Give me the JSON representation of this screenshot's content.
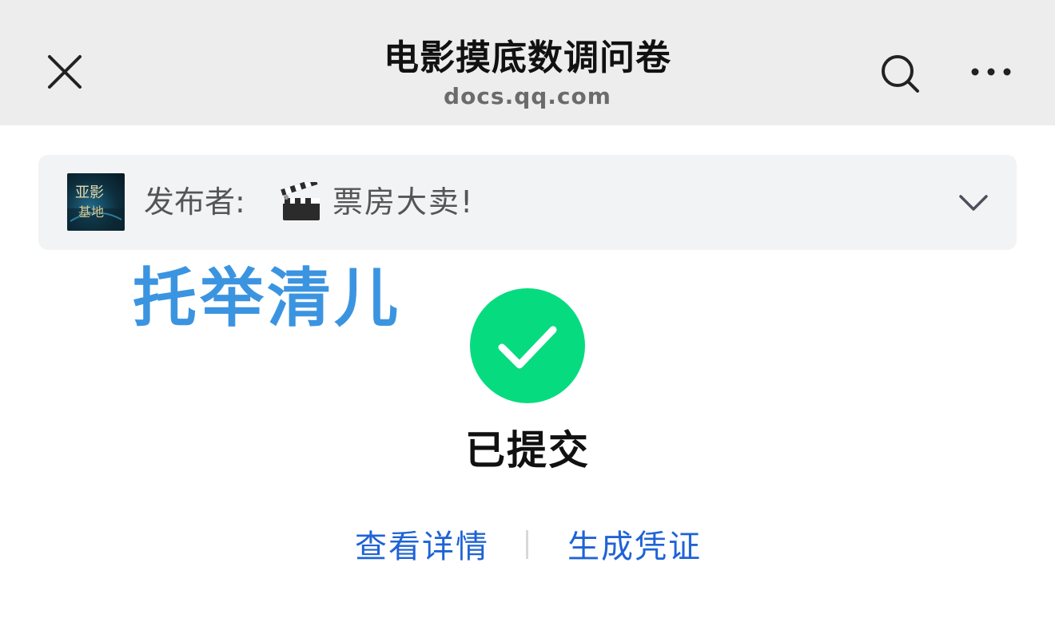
{
  "header": {
    "title": "电影摸底数调问卷",
    "subtitle": "docs.qq.com",
    "close_icon": "close-icon",
    "search_icon": "search-icon",
    "more_icon": "more-dots-icon"
  },
  "publisher": {
    "label": "发布者:",
    "emoji": "clapper-board",
    "name": "票房大卖!",
    "avatar_text": "亚影基地",
    "expand_icon": "chevron-down-icon"
  },
  "watermark": "托举清儿",
  "result": {
    "status": "已提交",
    "icon": "check-circle-icon",
    "accent": "#07db80"
  },
  "actions": {
    "details_label": "查看详情",
    "certificate_label": "生成凭证",
    "link_color": "#1f63d6"
  }
}
